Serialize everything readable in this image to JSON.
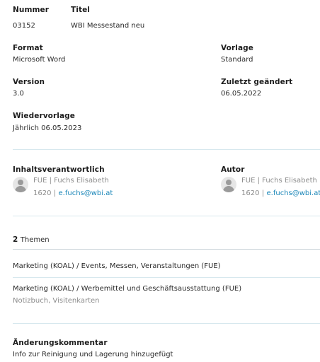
{
  "header": {
    "nummer_label": "Nummer",
    "titel_label": "Titel",
    "nummer_value": "03152",
    "titel_value": "WBI Messestand neu"
  },
  "meta": {
    "format_label": "Format",
    "format_value": "Microsoft Word",
    "vorlage_label": "Vorlage",
    "vorlage_value": "Standard",
    "version_label": "Version",
    "version_value": "3.0",
    "geaendert_label": "Zuletzt geändert",
    "geaendert_value": "06.05.2022",
    "wiedervorlage_label": "Wiedervorlage",
    "wiedervorlage_value": "Jährlich 06.05.2023"
  },
  "people": {
    "responsible_label": "Inhaltsverantwortlich",
    "responsible": {
      "code_name": "FUE | Fuchs Elisabeth",
      "phone": "1620",
      "separator": "|",
      "email": "e.fuchs@wbi.at"
    },
    "author_label": "Autor",
    "author": {
      "code_name": "FUE | Fuchs Elisabeth",
      "phone": "1620",
      "separator": "|",
      "email": "e.fuchs@wbi.at"
    }
  },
  "topics": {
    "count": "2",
    "count_label": "Themen",
    "items": [
      {
        "title": "Marketing (KOAL) / Events, Messen, Veranstaltungen (FUE)",
        "subtitle": ""
      },
      {
        "title": "Marketing (KOAL) / Werbemittel und Geschäftsausstattung (FUE)",
        "subtitle": "Notizbuch, Visitenkarten"
      }
    ]
  },
  "comment": {
    "label": "Änderungskommentar",
    "value": "Info zur Reinigung und Lagerung hinzugefügt"
  }
}
